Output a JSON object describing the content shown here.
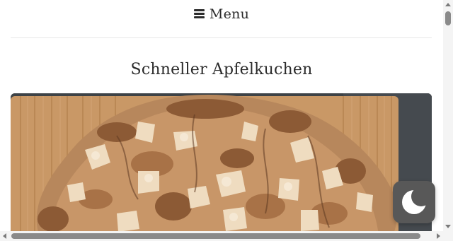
{
  "header": {
    "menu_icon": "hamburger-icon",
    "menu_label": "Menu"
  },
  "article": {
    "title": "Schneller Apfelkuchen",
    "image_subject": "apple cake on a wooden cutting board"
  },
  "dark_mode_toggle": {
    "icon": "moon-icon"
  },
  "colors": {
    "text": "#2b2b2b",
    "toggle_bg": "#585858",
    "moon": "#ffffff",
    "scrollbar_thumb": "#8a8a8a"
  }
}
